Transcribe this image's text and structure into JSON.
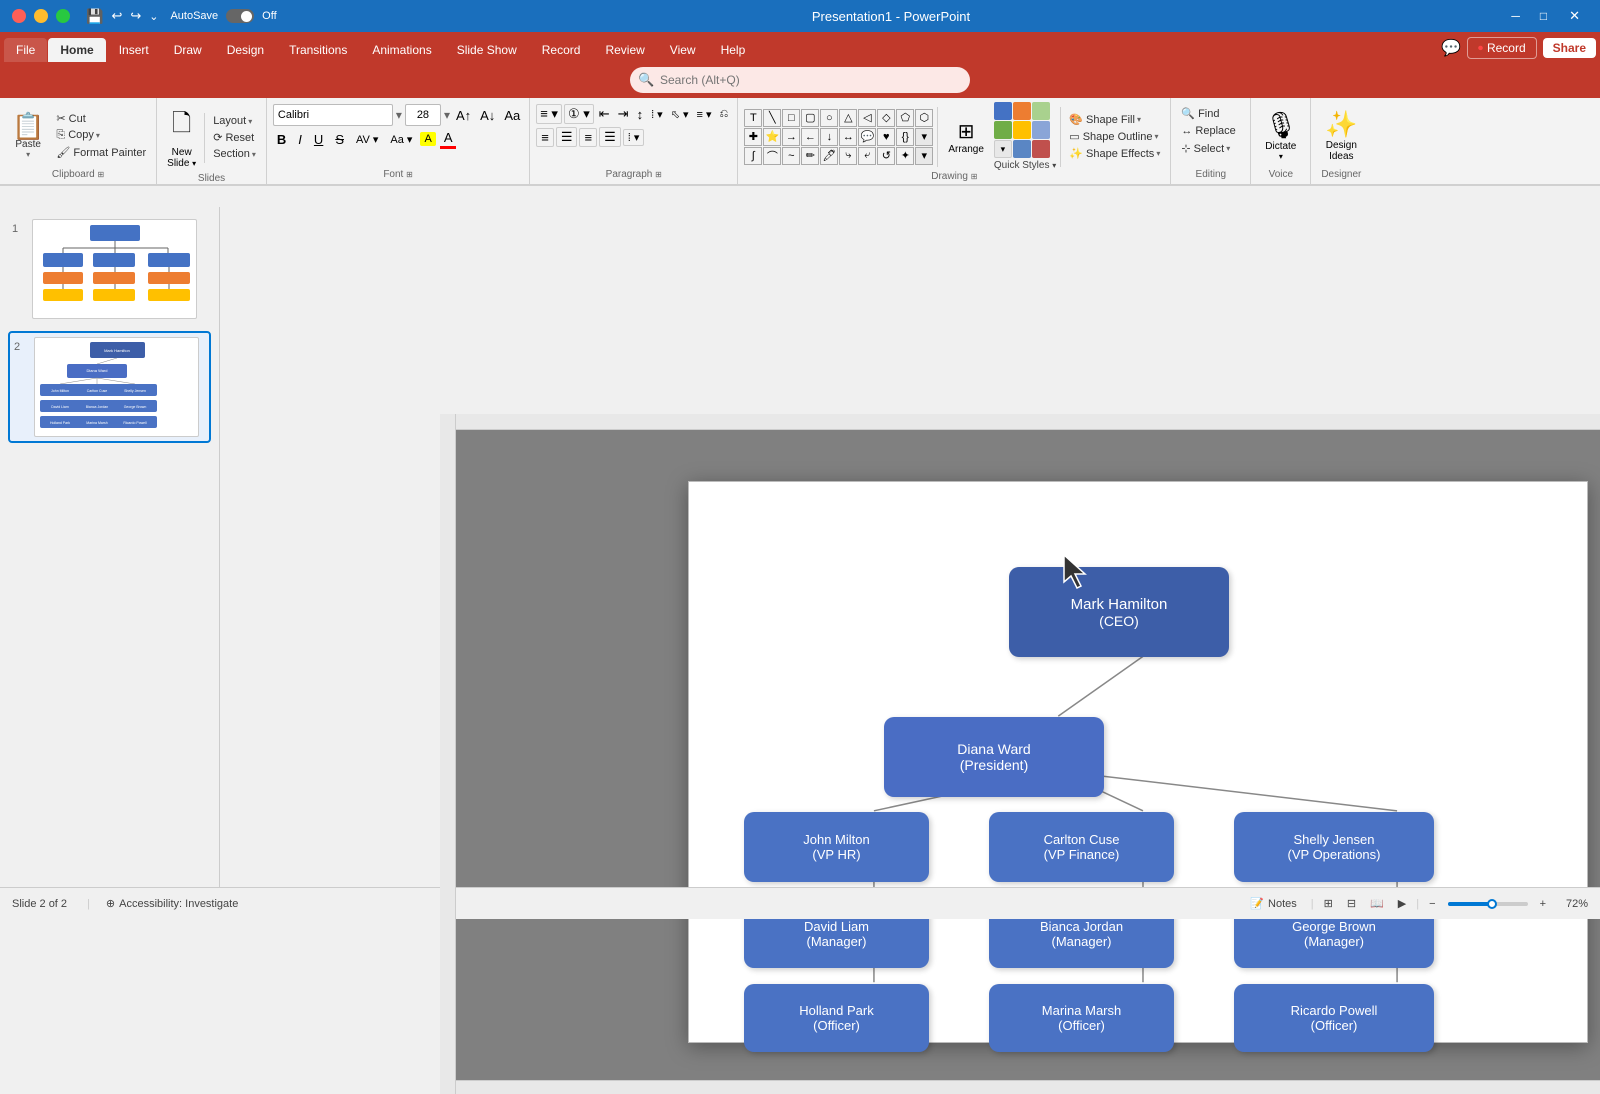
{
  "titlebar": {
    "traffic_lights": [
      "red",
      "yellow",
      "green"
    ],
    "title": "Presentation1 - PowerPoint",
    "window_controls": [
      "─",
      "□",
      "✕"
    ]
  },
  "quickaccess": {
    "autosave_label": "AutoSave",
    "autosave_state": "Off",
    "buttons": [
      "💾",
      "↩",
      "↪",
      "⊞",
      "⌄"
    ]
  },
  "search": {
    "placeholder": "Search (Alt+Q)"
  },
  "ribbon_tabs": [
    {
      "id": "file",
      "label": "File"
    },
    {
      "id": "home",
      "label": "Home",
      "active": true
    },
    {
      "id": "insert",
      "label": "Insert"
    },
    {
      "id": "draw",
      "label": "Draw"
    },
    {
      "id": "design",
      "label": "Design"
    },
    {
      "id": "transitions",
      "label": "Transitions"
    },
    {
      "id": "animations",
      "label": "Animations"
    },
    {
      "id": "slideshow",
      "label": "Slide Show"
    },
    {
      "id": "record",
      "label": "Record"
    },
    {
      "id": "review",
      "label": "Review"
    },
    {
      "id": "view",
      "label": "View"
    },
    {
      "id": "help",
      "label": "Help"
    }
  ],
  "ribbon": {
    "groups": [
      {
        "id": "clipboard",
        "label": "Clipboard",
        "tools": [
          "Paste",
          "Cut",
          "Copy",
          "Format Painter"
        ]
      },
      {
        "id": "slides",
        "label": "Slides",
        "tools": [
          "New Slide",
          "Layout",
          "Reset",
          "Section"
        ]
      },
      {
        "id": "font",
        "label": "Font",
        "font_name": "Calibri",
        "font_size": "28"
      },
      {
        "id": "paragraph",
        "label": "Paragraph"
      },
      {
        "id": "drawing",
        "label": "Drawing",
        "tools": [
          "Arrange",
          "Quick Styles",
          "Shape Fill",
          "Shape Outline",
          "Shape Effects"
        ]
      },
      {
        "id": "editing",
        "label": "Editing",
        "tools": [
          "Find",
          "Replace",
          "Select"
        ]
      },
      {
        "id": "voice",
        "label": "Voice",
        "tools": [
          "Dictate"
        ]
      },
      {
        "id": "designer",
        "label": "Designer",
        "tools": [
          "Design Ideas"
        ]
      }
    ]
  },
  "toolbar_right": {
    "share_label": "Share",
    "record_label": "Record",
    "comment_icon": "💬"
  },
  "slides": [
    {
      "id": 1,
      "number": "1",
      "type": "org_chart_compact"
    },
    {
      "id": 2,
      "number": "2",
      "type": "org_chart_full",
      "active": true
    }
  ],
  "org_chart": {
    "ceo": {
      "name": "Mark Hamilton",
      "title": "CEO"
    },
    "president": {
      "name": "Diana Ward",
      "title": "President"
    },
    "vps": [
      {
        "name": "John Milton",
        "title": "VP HR"
      },
      {
        "name": "Carlton Cuse",
        "title": "VP Finance"
      },
      {
        "name": "Shelly Jensen",
        "title": "VP Operations"
      }
    ],
    "managers": [
      {
        "name": "David Liam",
        "title": "Manager"
      },
      {
        "name": "Bianca Jordan",
        "title": "Manager"
      },
      {
        "name": "George Brown",
        "title": "Manager"
      }
    ],
    "officers": [
      {
        "name": "Holland Park",
        "title": "Officer"
      },
      {
        "name": "Marina Marsh",
        "title": "Officer"
      },
      {
        "name": "Ricardo Powell",
        "title": "Officer"
      }
    ]
  },
  "statusbar": {
    "slide_count": "Slide 2 of 2",
    "accessibility": "Accessibility: Investigate",
    "notes_label": "Notes",
    "view_normal": "Normal",
    "view_slide_sorter": "Slide Sorter",
    "view_reading": "Reading View",
    "view_slideshow": "Slide Show",
    "zoom_level": "72%"
  }
}
